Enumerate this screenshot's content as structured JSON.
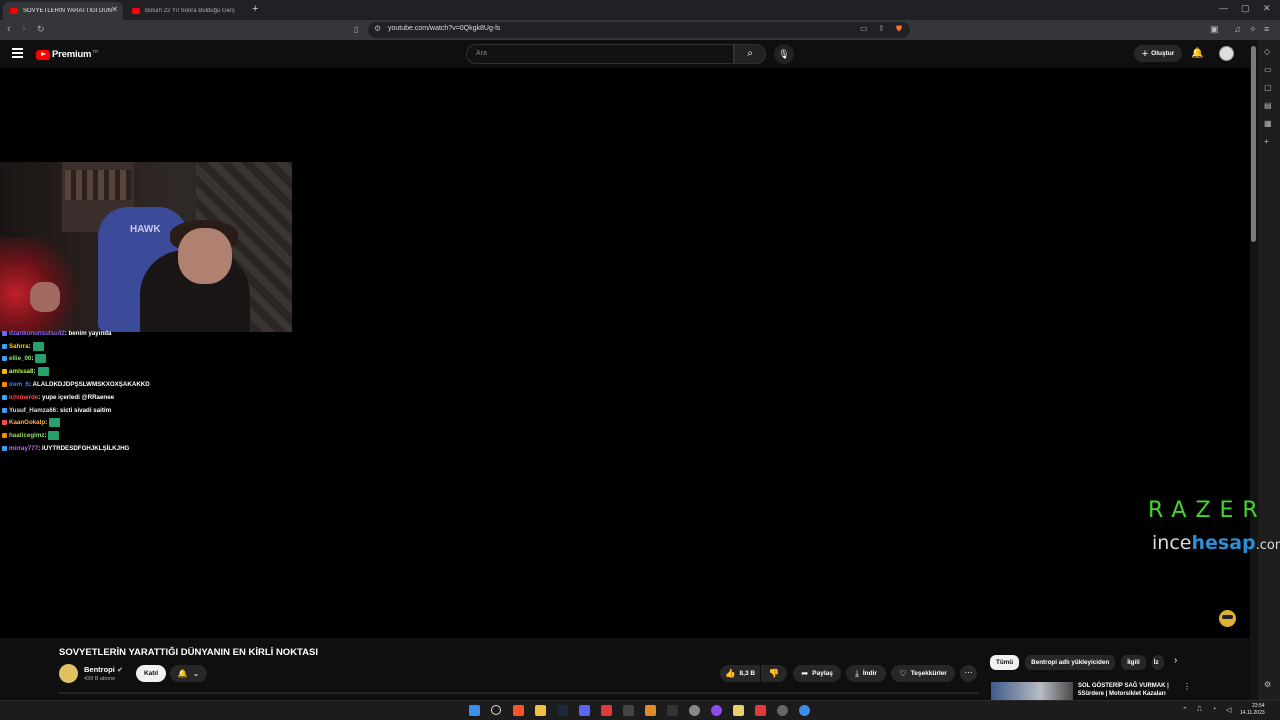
{
  "browser": {
    "tabs": [
      {
        "label": "SOVYETLERİN YARATTIĞI DÜNYA",
        "active": true
      },
      {
        "label": "Bolum 22 Yıl Sonra Bulduğu Gerçek",
        "active": false
      }
    ],
    "new_tab": "+",
    "window_controls": [
      "—",
      "▢",
      "✕"
    ],
    "url": "youtube.com/watch?v=0Qkgk8Ug-ls",
    "icons": [
      "bookmark-icon",
      "site-info-icon",
      "screenshot-icon",
      "share-icon",
      "brave-shield-icon"
    ]
  },
  "masthead": {
    "logo": "Premium",
    "logo_sup": "TR",
    "search_placeholder": "Ara",
    "create_label": "Oluştur"
  },
  "video": {
    "webcam_chair_text": "HAWK",
    "chat": [
      {
        "user": "dzankonunsulsu42",
        "msg": ": benim yayında",
        "color": "#9b6bff",
        "badge": "#6a6aff",
        "emote": false
      },
      {
        "user": "Sahrra",
        "msg": " :",
        "color": "#ffd400",
        "badge": "#3aa0ff",
        "emote": true
      },
      {
        "user": "ellie_00",
        "msg": " :",
        "color": "#8ae36b",
        "badge": "#3aa0ff",
        "emote": true
      },
      {
        "user": "amissa8",
        "msg": " :",
        "color": "#b8ff3a",
        "badge": "#ffb000",
        "emote": true
      },
      {
        "user": "irem_6",
        "msg": " : ALALDKDJDPŞSLWMSKXOXŞAKAKKD",
        "color": "#4a7dff",
        "badge": "#ff8a00",
        "emote": false
      },
      {
        "user": "ichimerde",
        "msg": " : yupe içerledi @RRaenee",
        "color": "#ff4a4a",
        "badge": "#3aa0ff",
        "emote": false
      },
      {
        "user": "Yusuf_Hamza66",
        "msg": " : sicti sivadi saitim",
        "color": "#dcdcdc",
        "badge": "#3aa0ff",
        "emote": false
      },
      {
        "user": "KaanGokalp",
        "msg": " :",
        "color": "#ffb347",
        "badge": "#ff4a4a",
        "emote": true
      },
      {
        "user": "haaticegimz",
        "msg": " :",
        "color": "#9bd86b",
        "badge": "#ff8a00",
        "emote": true
      },
      {
        "user": "mirray777",
        "msg": " : IUYTRDESDFGHJKLŞİLKJHG",
        "color": "#c06bff",
        "badge": "#3aa0ff",
        "emote": false
      }
    ],
    "sponsor_brand": "RAZER",
    "sponsor_site_a": "ince",
    "sponsor_site_b": "hesap",
    "sponsor_site_c": ".com"
  },
  "info": {
    "title": "SOVYETLERİN YARATTIĞI DÜNYANIN EN KİRLİ NOKTASI",
    "channel": "Bentropi",
    "subscribers": "439 B abone",
    "join_label": "Katıl",
    "like_count": "8,3 B",
    "share_label": "Paylaş",
    "download_label": "İndir",
    "thanks_label": "Teşekkürler"
  },
  "recommendations": {
    "chips": [
      "Tümü",
      "Bentropi adlı yükleyiciden",
      "İlgili",
      "İz"
    ],
    "first_title": "SOL GÖSTERİP SAĞ VURMAK | 5Sürdere | Motorsiklet Kazaları"
  },
  "taskbar": {
    "time": "23:54",
    "date": "14.11.2023"
  }
}
